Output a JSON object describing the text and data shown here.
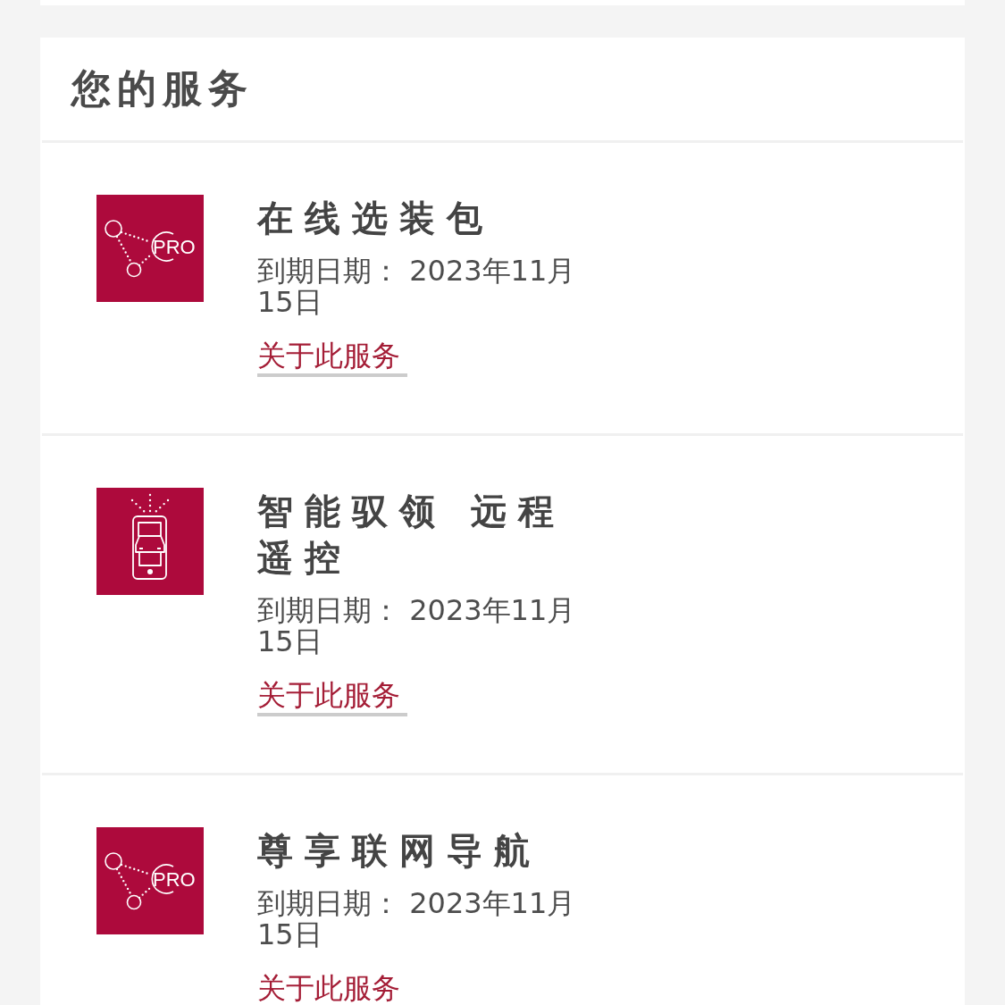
{
  "services_card": {
    "title": "您的服务",
    "services": [
      {
        "kind": "pro",
        "badge": "PRO",
        "name": "在线选装包",
        "expiry": "到期日期： 2023年11月15日",
        "link": "关于此服务"
      },
      {
        "kind": "remote",
        "name": "智能驭领 远程遥控",
        "expiry": "到期日期： 2023年11月15日",
        "link": "关于此服务"
      },
      {
        "kind": "pro",
        "badge": "PRO",
        "name": "尊享联网导航",
        "expiry": "到期日期： 2023年11月15日",
        "link": "关于此服务"
      }
    ]
  }
}
